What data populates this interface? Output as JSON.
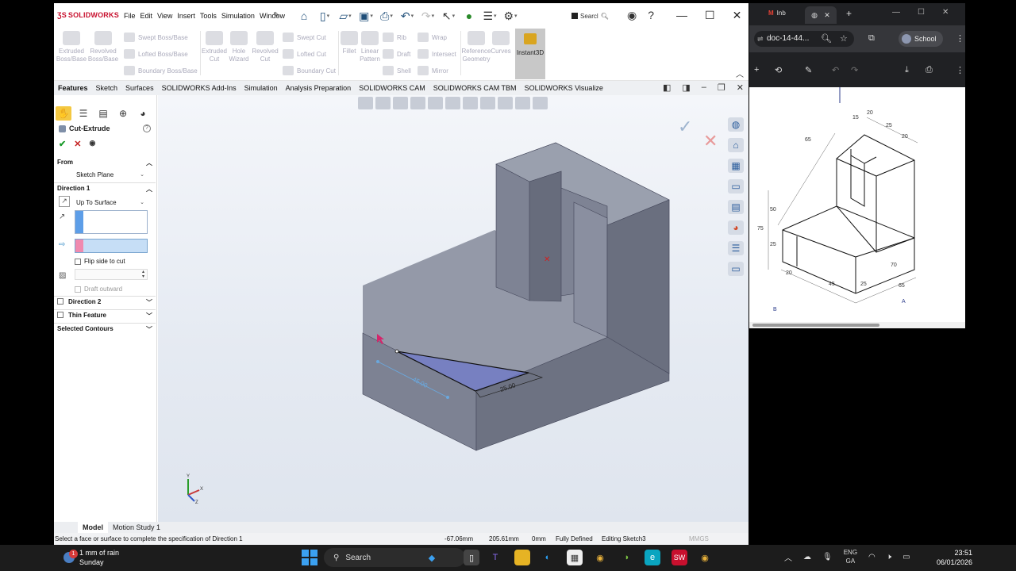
{
  "sw": {
    "logo": "SOLIDWORKS",
    "menus": [
      "File",
      "Edit",
      "View",
      "Insert",
      "Tools",
      "Simulation",
      "Window"
    ],
    "search_label": "Searcl",
    "ribbon": {
      "extruded_boss": "Extruded Boss/Base",
      "revolved_boss": "Revolved Boss/Base",
      "swept_boss": "Swept Boss/Base",
      "lofted_boss": "Lofted Boss/Base",
      "boundary_boss": "Boundary Boss/Base",
      "extruded_cut": "Extruded Cut",
      "hole_wizard": "Hole Wizard",
      "revolved_cut": "Revolved Cut",
      "swept_cut": "Swept Cut",
      "lofted_cut": "Lofted Cut",
      "boundary_cut": "Boundary Cut",
      "fillet": "Fillet",
      "linear_pattern": "Linear Pattern",
      "rib": "Rib",
      "wrap": "Wrap",
      "draft": "Draft",
      "intersect": "Intersect",
      "shell": "Shell",
      "mirror": "Mirror",
      "ref_geometry": "Reference Geometry",
      "curves": "Curves",
      "instant3d": "Instant3D"
    },
    "tabs": [
      "Features",
      "Sketch",
      "Surfaces",
      "SOLIDWORKS Add-Ins",
      "Simulation",
      "Analysis Preparation",
      "SOLIDWORKS CAM",
      "SOLIDWORKS CAM TBM",
      "SOLIDWORKS Visualize"
    ],
    "panel": {
      "title": "Cut-Extrude",
      "from_label": "From",
      "from_value": "Sketch Plane",
      "direction1_label": "Direction 1",
      "direction1_value": "Up To Surface",
      "flip_label": "Flip side to cut",
      "draft_label": "Draft outward",
      "direction2_label": "Direction 2",
      "thin_label": "Thin Feature",
      "contours_label": "Selected Contours"
    },
    "dims": {
      "d1": "25.00",
      "d2": "45.00"
    },
    "bottom_tabs": [
      "Model",
      "Motion Study 1"
    ],
    "status": {
      "message": "Select a face or surface to complete the specification of Direction 1",
      "x": "-67.06mm",
      "y": "205.61mm",
      "z": "0mm",
      "defined": "Fully Defined",
      "editing": "Editing Sketch3",
      "units": "MMGS"
    }
  },
  "browser": {
    "tab1": "Inb",
    "url": "doc-14-44...",
    "profile": "School"
  },
  "drawing": {
    "labels": [
      "65",
      "15",
      "20",
      "25",
      "20",
      "50",
      "75",
      "25",
      "20",
      "45",
      "25",
      "70",
      "65",
      "B",
      "A"
    ]
  },
  "taskbar": {
    "weather_line1": "1 mm of rain",
    "weather_line2": "Sunday",
    "weather_badge": "1",
    "search": "Search",
    "lang1": "ENG",
    "lang2": "GA",
    "time": "23:51",
    "date": "06/01/2026"
  }
}
